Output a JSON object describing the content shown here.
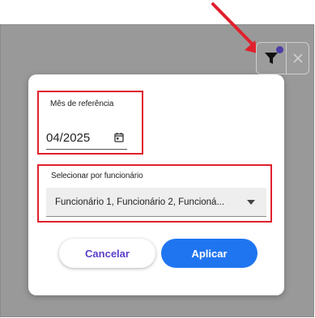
{
  "toolbar": {
    "filter_icon": "filter-icon",
    "close_icon": "close-icon",
    "indicator_color": "#4b3ea6"
  },
  "annotation": {
    "arrow_color": "#e0202d",
    "highlight_color": "#e0202d"
  },
  "dialog": {
    "month_field": {
      "label": "Mês de referência",
      "value": "04/2025",
      "icon": "calendar-icon"
    },
    "employee_field": {
      "label": "Selecionar por funcionário",
      "value": "Funcionário 1, Funcionário 2, Funcioná..."
    },
    "buttons": {
      "cancel": "Cancelar",
      "apply": "Aplicar"
    },
    "colors": {
      "primary": "#1f75f0",
      "cancel_text": "#5b3fc9"
    }
  }
}
